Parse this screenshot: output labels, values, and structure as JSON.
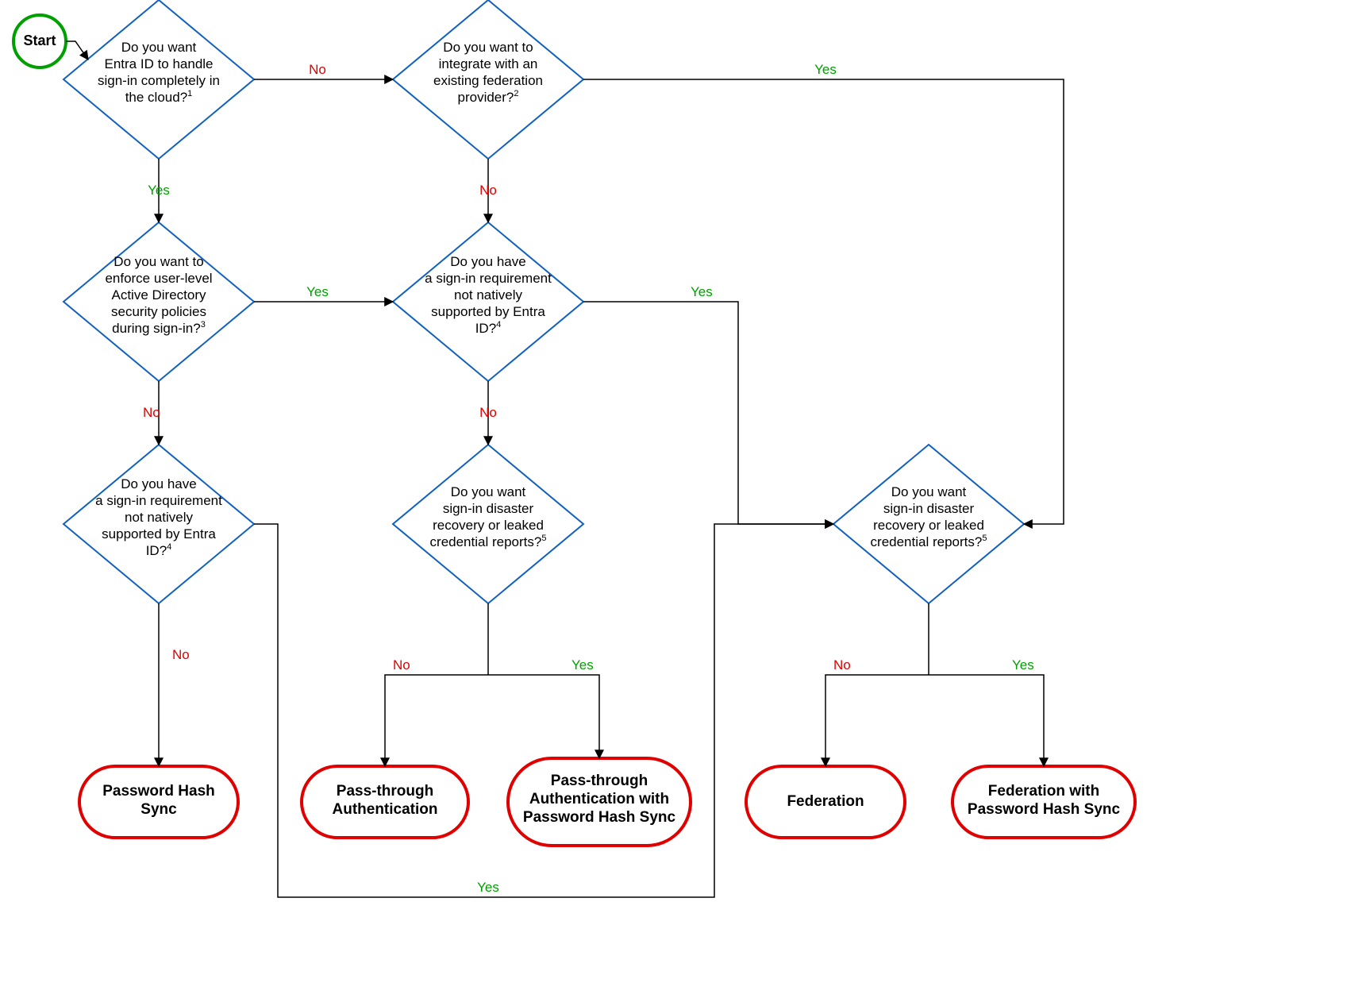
{
  "diagram": {
    "start": "Start",
    "labels": {
      "yes": "Yes",
      "no": "No"
    },
    "decisions": {
      "d1": {
        "lines": [
          "Do you want",
          "Entra ID to handle",
          "sign-in completely in",
          "the cloud?"
        ],
        "sup": "1"
      },
      "d2": {
        "lines": [
          "Do you want to",
          "integrate with an",
          "existing federation",
          "provider?"
        ],
        "sup": "2"
      },
      "d3": {
        "lines": [
          "Do you want to",
          "enforce user-level",
          "Active Directory",
          "security policies",
          "during sign-in?"
        ],
        "sup": "3"
      },
      "d4": {
        "lines": [
          "Do you have",
          "a sign-in requirement",
          "not natively",
          "supported by Entra",
          "ID?"
        ],
        "sup": "4"
      },
      "d5": {
        "lines": [
          "Do you have",
          "a sign-in requirement",
          "not natively",
          "supported by Entra",
          "ID?"
        ],
        "sup": "4"
      },
      "d6": {
        "lines": [
          "Do you want",
          "sign-in disaster",
          "recovery or leaked",
          "credential reports?"
        ],
        "sup": "5"
      },
      "d7": {
        "lines": [
          "Do you want",
          "sign-in disaster",
          "recovery or leaked",
          "credential reports?"
        ],
        "sup": "5"
      }
    },
    "terminators": {
      "t1": {
        "lines": [
          "Password Hash",
          "Sync"
        ]
      },
      "t2": {
        "lines": [
          "Pass-through",
          "Authentication"
        ]
      },
      "t3": {
        "lines": [
          "Pass-through",
          "Authentication with",
          "Password Hash Sync"
        ]
      },
      "t4": {
        "lines": [
          "Federation"
        ]
      },
      "t5": {
        "lines": [
          "Federation with",
          "Password Hash Sync"
        ]
      }
    }
  }
}
